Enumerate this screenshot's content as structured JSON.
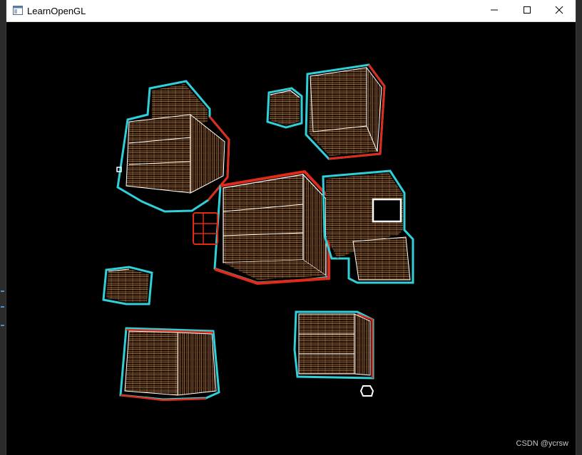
{
  "window": {
    "title": "LearnOpenGL",
    "controls": [
      "minimize",
      "maximize",
      "close"
    ]
  },
  "scene": {
    "description_icons": [
      "app-window-icon",
      "minimize-icon",
      "maximize-icon",
      "close-icon"
    ],
    "outline_colors": {
      "cyan": "#2fd0d8",
      "red": "#e02a1a",
      "white": "#ffffff",
      "crate_wood": "#8a5a2c"
    },
    "crate_count": 10
  },
  "watermark": {
    "text": "CSDN @ycrsw"
  }
}
